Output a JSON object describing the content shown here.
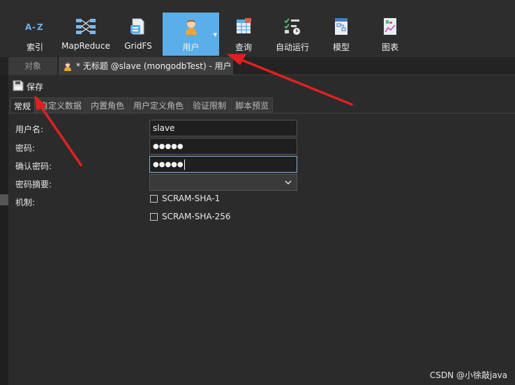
{
  "toolbar": {
    "buttons": [
      {
        "label": "索引",
        "icon": "az-index-icon"
      },
      {
        "label": "MapReduce",
        "icon": "mapreduce-icon"
      },
      {
        "label": "GridFS",
        "icon": "gridfs-icon"
      },
      {
        "label": "用户",
        "icon": "user-icon",
        "active": true
      },
      {
        "label": "查询",
        "icon": "query-icon"
      },
      {
        "label": "自动运行",
        "icon": "auto-run-icon"
      },
      {
        "label": "模型",
        "icon": "model-icon"
      },
      {
        "label": "图表",
        "icon": "chart-icon"
      }
    ]
  },
  "tabs": {
    "objects": "对象",
    "doc": "* 无标题 @slave (mongodbTest) - 用户"
  },
  "save": {
    "label": "保存"
  },
  "subtabs": [
    "常规",
    "自定义数据",
    "内置角色",
    "用户定义角色",
    "验证限制",
    "脚本预览"
  ],
  "form": {
    "username_label": "用户名:",
    "username_value": "slave",
    "password_label": "密码:",
    "password_value": "●●●●●",
    "confirm_label": "确认密码:",
    "confirm_value": "●●●●●",
    "digest_label": "密码摘要:",
    "digest_value": "",
    "mechanism_label": "机制:",
    "mechanisms": [
      "SCRAM-SHA-1",
      "SCRAM-SHA-256"
    ]
  },
  "watermark": "CSDN @小徐敲java",
  "colors": {
    "accent": "#5aaee9",
    "annotation": "#e02020"
  }
}
